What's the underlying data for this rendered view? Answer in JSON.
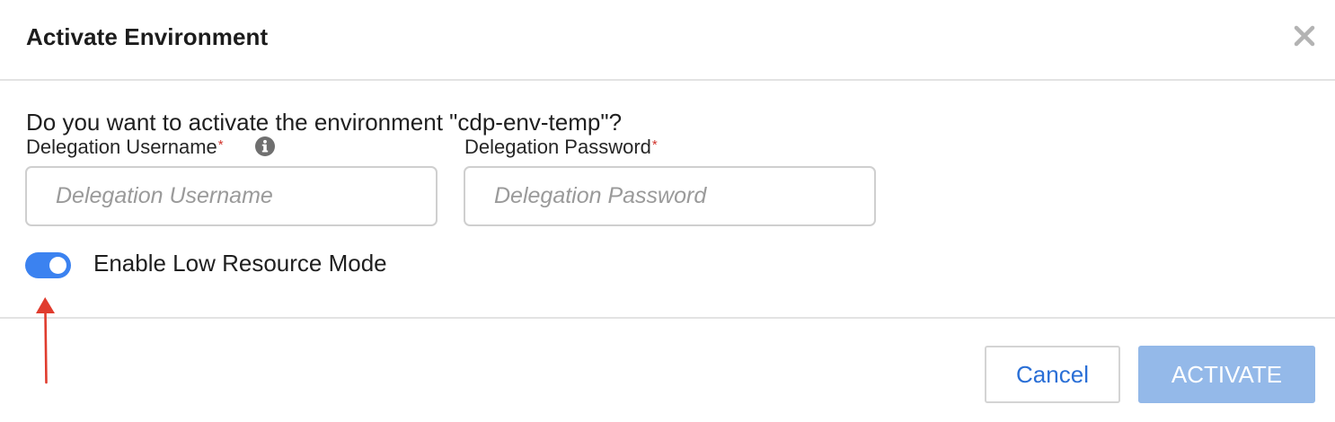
{
  "dialog": {
    "title": "Activate Environment",
    "close_icon": "close-icon",
    "question": "Do you want to activate the environment \"cdp-env-temp\"?",
    "fields": {
      "username": {
        "label": "Delegation Username",
        "required_marker": "*",
        "info_icon": "info-icon",
        "value": "",
        "placeholder": "Delegation Username"
      },
      "password": {
        "label": "Delegation Password",
        "required_marker": "*",
        "value": "",
        "placeholder": "Delegation Password"
      }
    },
    "low_resource_mode": {
      "label": "Enable Low Resource Mode",
      "enabled": true
    },
    "footer": {
      "cancel_label": "Cancel",
      "activate_label": "ACTIVATE",
      "activate_disabled": true
    }
  },
  "annotation": {
    "arrow_icon": "red-arrow-icon",
    "arrow_color": "#e03c2e"
  },
  "colors": {
    "accent": "#3b82f0",
    "required": "#d0342c",
    "activate_disabled_bg": "#94b9e9",
    "cancel_text": "#2a6fd6"
  }
}
